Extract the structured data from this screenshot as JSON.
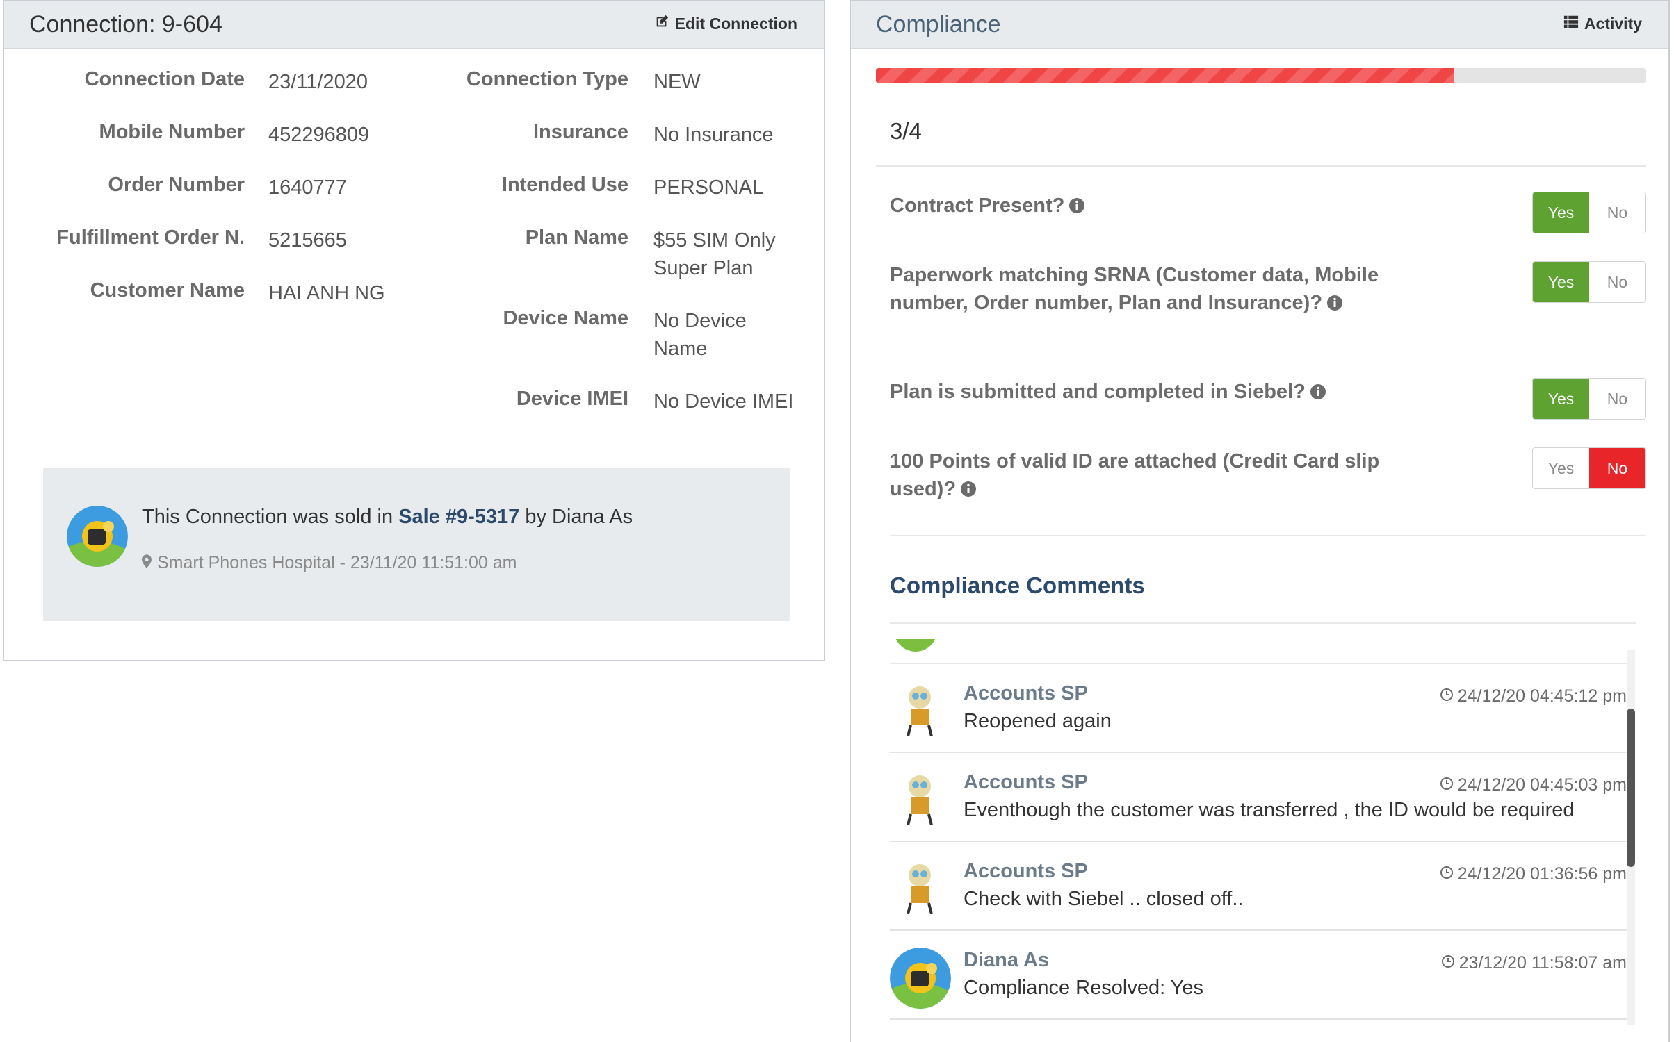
{
  "connection": {
    "title": "Connection: 9-604",
    "edit_label": "Edit Connection",
    "details_left": [
      {
        "label": "Connection Date",
        "value": "23/11/2020"
      },
      {
        "label": "Mobile Number",
        "value": "452296809"
      },
      {
        "label": "Order Number",
        "value": "1640777"
      },
      {
        "label": "Fulfillment Order N.",
        "value": "5215665"
      },
      {
        "label": "Customer Name",
        "value": "HAI ANH NG"
      }
    ],
    "details_right": [
      {
        "label": "Connection Type",
        "value": "NEW"
      },
      {
        "label": "Insurance",
        "value": "No Insurance"
      },
      {
        "label": "Intended Use",
        "value": "PERSONAL"
      },
      {
        "label": "Plan Name",
        "value": "$55 SIM Only Super Plan"
      },
      {
        "label": "Device Name",
        "value": "No Device Name"
      },
      {
        "label": "Device IMEI",
        "value": "No Device IMEI"
      }
    ],
    "sale": {
      "prefix": "This Connection was sold in ",
      "sale_link": "Sale #9-5317",
      "suffix": " by Diana As",
      "location": "Smart Phones Hospital - 23/11/20 11:51:00 am"
    }
  },
  "compliance": {
    "title": "Compliance",
    "activity_label": "Activity",
    "score": "3/4",
    "progress_fraction": 0.75,
    "questions": [
      {
        "text": "Contract Present?",
        "answer": "Yes"
      },
      {
        "text": "Paperwork matching SRNA (Customer data, Mobile number, Order number, Plan and Insurance)?",
        "answer": "Yes"
      },
      {
        "text": "Plan is submitted and completed in Siebel?",
        "answer": "Yes"
      },
      {
        "text": "100 Points of valid ID are attached (Credit Card slip used)?",
        "answer": "No"
      }
    ],
    "yes_label": "Yes",
    "no_label": "No",
    "comments_title": "Compliance Comments",
    "comments": [
      {
        "author": "Accounts SP",
        "time": "24/12/20 04:45:12 pm",
        "text": "Reopened again"
      },
      {
        "author": "Accounts SP",
        "time": "24/12/20 04:45:03 pm",
        "text": "Eventhough the customer was transferred , the ID would be required"
      },
      {
        "author": "Accounts SP",
        "time": "24/12/20 01:36:56 pm",
        "text": "Check with Siebel .. closed off.."
      },
      {
        "author": "Diana As",
        "time": "23/12/20 11:58:07 am",
        "text": "Compliance Resolved: Yes"
      }
    ]
  },
  "colors": {
    "header_bg": "#e7ebee",
    "yes_active": "#5ea232",
    "no_active": "#e8262a",
    "progress": "#f04545",
    "link": "#2c4a6b"
  }
}
